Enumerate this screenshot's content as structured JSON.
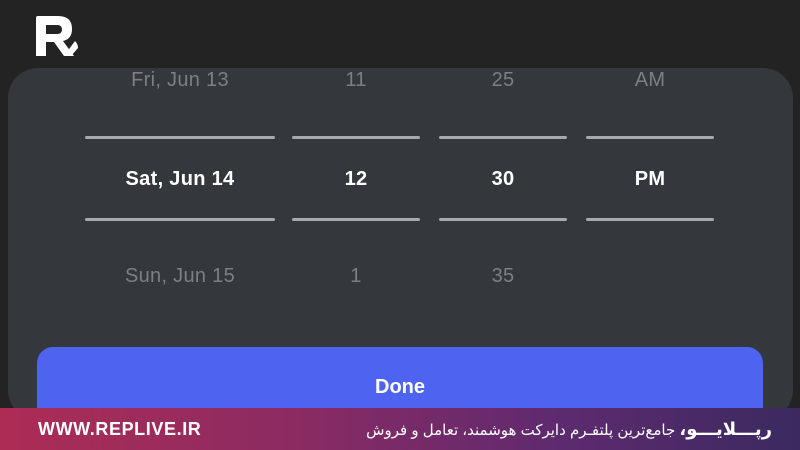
{
  "brand": {
    "logo_icon": "replive-logo-icon",
    "website": "WWW.REPLIVE.IR",
    "tagline_name": "رپـــلایـــو،",
    "tagline_text": " جامع‌ترین پلتفـرم دایرکت هوشمند، تعامل و فروش",
    "gradient": [
      "#ad2c55",
      "#3a2a5f"
    ]
  },
  "picker": {
    "date": [
      "Fri, Jun 13",
      "Sat, Jun 14",
      "Sun, Jun 15"
    ],
    "hour": [
      "11",
      "12",
      "1"
    ],
    "minute": [
      "25",
      "30",
      "35"
    ],
    "ampm": [
      "AM",
      "PM",
      ""
    ],
    "selected_index": 1
  },
  "done_label": "Done",
  "colors": {
    "background": "#232323",
    "sheet": "#34373c",
    "accent": "#4e64f1",
    "selected_text": "#ffffff",
    "dim_text": "#7c7f84",
    "divider": "#a7a9ad"
  }
}
